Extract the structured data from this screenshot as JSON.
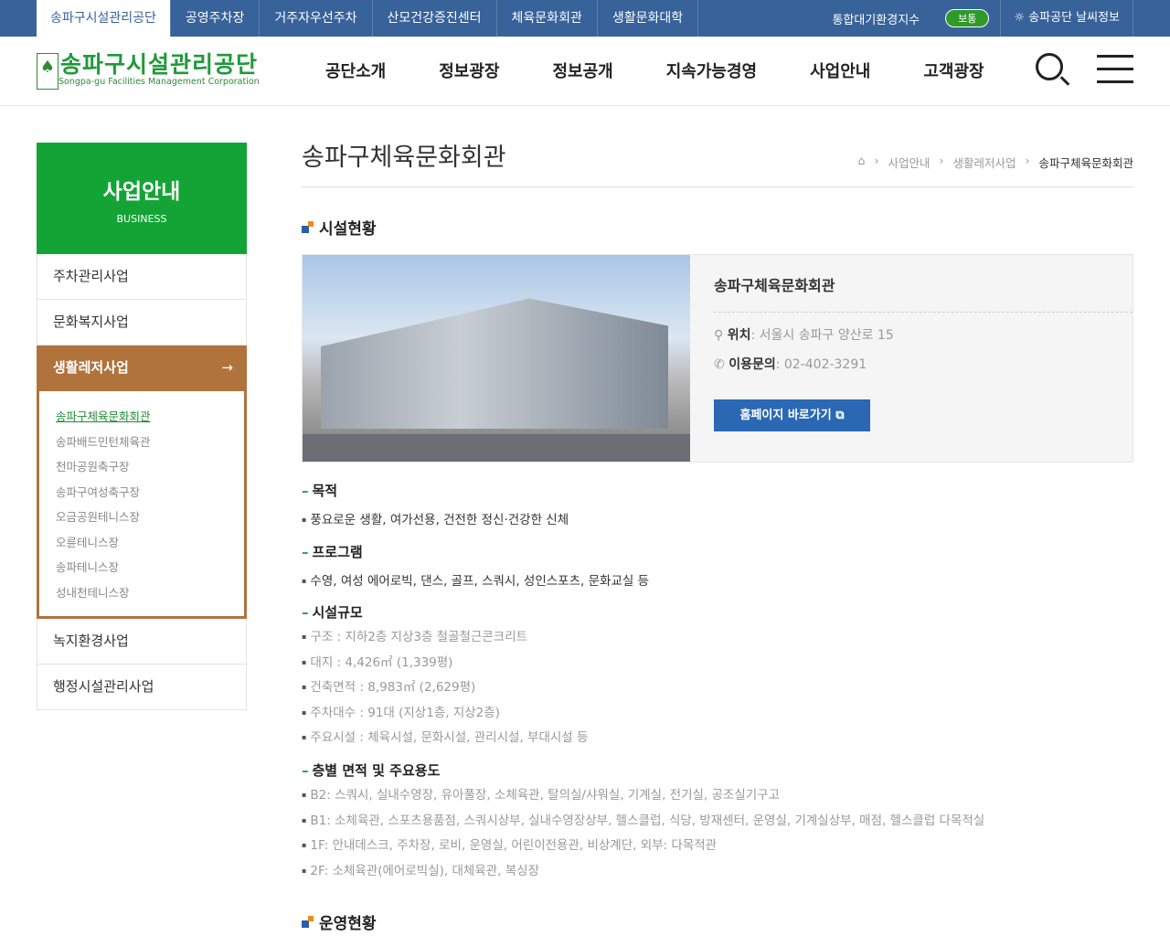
{
  "topbar": {
    "tabs": [
      "송파구시설관리공단",
      "공영주차장",
      "거주자우선주차",
      "산모건강증진센터",
      "체육문화회관",
      "생활문화대학"
    ],
    "air_label": "통합대기환경지수",
    "air_status": "보통",
    "weather": "송파공단 날씨정보"
  },
  "header": {
    "logo_ko": "송파구시설관리공단",
    "logo_en": "Songpa-gu Facilities Management Corporation",
    "gnb": [
      "공단소개",
      "정보광장",
      "정보공개",
      "지속가능경영",
      "사업안내",
      "고객광장"
    ]
  },
  "side": {
    "title": "사업안내",
    "subtitle": "BUSINESS",
    "items": [
      "주차관리사업",
      "문화복지사업",
      "생활레저사업",
      "녹지환경사업",
      "행정시설관리사업"
    ],
    "sub": [
      "송파구체육문화회관",
      "송파배드민턴체육관",
      "천마공원축구장",
      "송파구여성축구장",
      "오금공원테니스장",
      "오륜테니스장",
      "송파테니스장",
      "성내천테니스장"
    ]
  },
  "page": {
    "title": "송파구체육문화회관",
    "breadcrumb": [
      "사업안내",
      "생활레저사업",
      "송파구체육문화회관"
    ]
  },
  "facility": {
    "heading": "시설현황",
    "name": "송파구체육문화회관",
    "loc_label": "위치",
    "loc": ": 서울시 송파구 양산로 15",
    "tel_label": "이용문의",
    "tel": ": 02-402-3291",
    "button": "홈페이지 바로가기"
  },
  "purpose": {
    "title": "목적",
    "items": [
      "풍요로운 생활, 여가선용, 건전한 정신·건강한 신체"
    ]
  },
  "program": {
    "title": "프로그램",
    "items": [
      "수영, 여성 에어로빅, 댄스, 골프, 스쿼시, 성인스포츠, 문화교실 등"
    ]
  },
  "scale": {
    "title": "시설규모",
    "items": [
      "구조 : 지하2층 지상3층 철골철근콘크리트",
      "대지 : 4,426㎡ (1,339평)",
      "건축면적 : 8,983㎡ (2,629평)",
      "주차대수 : 91대 (지상1층, 지상2층)",
      "주요시설 : 체육시설, 문화시설, 관리시설, 부대시설 등"
    ]
  },
  "floors": {
    "title": "층별 면적 및 주요용도",
    "items": [
      "B2: 스쿼시, 실내수영장, 유아풀장, 소체육관, 탈의실/샤워실, 기계실, 전기실, 공조실기구고",
      "B1: 소체육관, 스포츠용품점, 스쿼시상부, 실내수영장상부, 헬스클럽, 식당, 방재센터, 운영실, 기계실상부, 매점, 헬스클럽 다목적실",
      "1F: 안내데스크, 주차장, 로비, 운영실, 어린이전용관, 비상계단, 외부: 다목적관",
      "2F: 소체육관(에어로빅실), 대체육관, 복싱장"
    ]
  },
  "operation": {
    "heading": "운영현황"
  }
}
